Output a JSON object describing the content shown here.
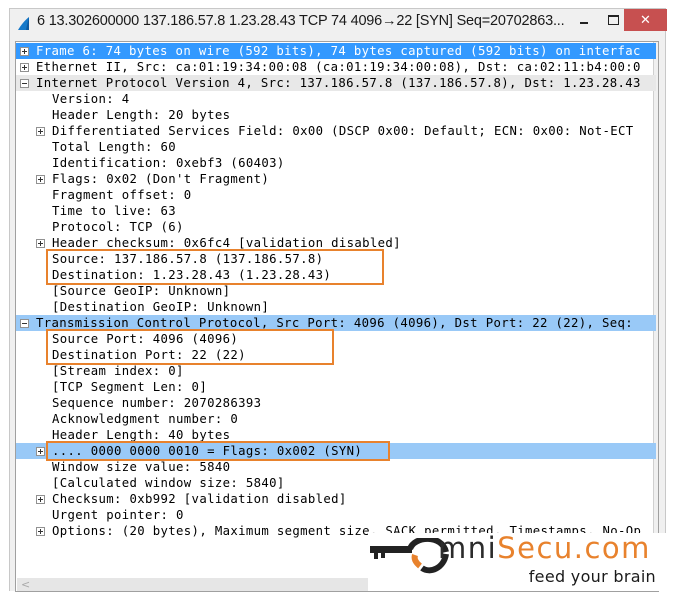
{
  "window": {
    "title": "6 13.302600000 137.186.57.8 1.23.28.43 TCP 74 4096→22 [SYN] Seq=20702863...",
    "app_icon": "wireshark-fin-icon",
    "controls": {
      "minimize": "minimize-icon",
      "maximize": "maximize-icon",
      "close": "✕"
    }
  },
  "tree": {
    "rows": [
      {
        "text": "Frame 6: 74 bytes on wire (592 bits), 74 bytes captured (592 bits) on interfac",
        "level": 0,
        "expander": "plus",
        "state": "selected"
      },
      {
        "text": "Ethernet II, Src: ca:01:19:34:00:08 (ca:01:19:34:00:08), Dst: ca:02:11:b4:00:0",
        "level": 0,
        "expander": "plus",
        "state": "normal"
      },
      {
        "text": "Internet Protocol Version 4, Src: 137.186.57.8 (137.186.57.8), Dst: 1.23.28.43",
        "level": 0,
        "expander": "minus",
        "state": "hover"
      },
      {
        "text": "Version: 4",
        "level": 1,
        "expander": "none",
        "state": "normal"
      },
      {
        "text": "Header Length: 20 bytes",
        "level": 1,
        "expander": "none",
        "state": "normal"
      },
      {
        "text": "Differentiated Services Field: 0x00 (DSCP 0x00: Default; ECN: 0x00: Not-ECT",
        "level": 1,
        "expander": "plus",
        "state": "normal"
      },
      {
        "text": "Total Length: 60",
        "level": 1,
        "expander": "none",
        "state": "normal"
      },
      {
        "text": "Identification: 0xebf3 (60403)",
        "level": 1,
        "expander": "none",
        "state": "normal"
      },
      {
        "text": "Flags: 0x02 (Don't Fragment)",
        "level": 1,
        "expander": "plus",
        "state": "normal"
      },
      {
        "text": "Fragment offset: 0",
        "level": 1,
        "expander": "none",
        "state": "normal"
      },
      {
        "text": "Time to live: 63",
        "level": 1,
        "expander": "none",
        "state": "normal"
      },
      {
        "text": "Protocol: TCP (6)",
        "level": 1,
        "expander": "none",
        "state": "normal"
      },
      {
        "text": "Header checksum: 0x6fc4 [validation disabled]",
        "level": 1,
        "expander": "plus",
        "state": "normal"
      },
      {
        "text": "Source: 137.186.57.8 (137.186.57.8)",
        "level": 1,
        "expander": "none",
        "state": "normal"
      },
      {
        "text": "Destination: 1.23.28.43 (1.23.28.43)",
        "level": 1,
        "expander": "none",
        "state": "normal"
      },
      {
        "text": "[Source GeoIP: Unknown]",
        "level": 1,
        "expander": "none",
        "state": "normal"
      },
      {
        "text": "[Destination GeoIP: Unknown]",
        "level": 1,
        "expander": "none",
        "state": "normal"
      },
      {
        "text": "Transmission Control Protocol, Src Port: 4096 (4096), Dst Port: 22 (22), Seq:",
        "level": 0,
        "expander": "minus",
        "state": "selected-light"
      },
      {
        "text": "Source Port: 4096 (4096)",
        "level": 1,
        "expander": "none",
        "state": "normal"
      },
      {
        "text": "Destination Port: 22 (22)",
        "level": 1,
        "expander": "none",
        "state": "normal"
      },
      {
        "text": "[Stream index: 0]",
        "level": 1,
        "expander": "none",
        "state": "normal"
      },
      {
        "text": "[TCP Segment Len: 0]",
        "level": 1,
        "expander": "none",
        "state": "normal"
      },
      {
        "text": "Sequence number: 2070286393",
        "level": 1,
        "expander": "none",
        "state": "normal"
      },
      {
        "text": "Acknowledgment number: 0",
        "level": 1,
        "expander": "none",
        "state": "normal"
      },
      {
        "text": "Header Length: 40 bytes",
        "level": 1,
        "expander": "none",
        "state": "normal"
      },
      {
        "text": ".... 0000 0000 0010 = Flags: 0x002 (SYN)",
        "level": 1,
        "expander": "plus",
        "state": "selected-light"
      },
      {
        "text": "Window size value: 5840",
        "level": 1,
        "expander": "none",
        "state": "normal"
      },
      {
        "text": "[Calculated window size: 5840]",
        "level": 1,
        "expander": "none",
        "state": "normal"
      },
      {
        "text": "Checksum: 0xb992 [validation disabled]",
        "level": 1,
        "expander": "plus",
        "state": "normal"
      },
      {
        "text": "Urgent pointer: 0",
        "level": 1,
        "expander": "none",
        "state": "normal"
      },
      {
        "text": "Options: (20 bytes), Maximum segment size, SACK permitted, Timestamps, No-Op",
        "level": 1,
        "expander": "plus",
        "state": "normal"
      }
    ],
    "highlight_boxes": [
      {
        "label": "ip-source-destination-highlight",
        "rows": [
          13,
          14
        ]
      },
      {
        "label": "tcp-ports-highlight",
        "rows": [
          18,
          19
        ]
      },
      {
        "label": "tcp-flags-highlight",
        "rows": [
          25,
          25
        ]
      }
    ],
    "scroll_left_arrow": "<"
  },
  "watermark": {
    "brand_prefix": "O",
    "brand_dark": "mni",
    "brand_accent": "Secu.com",
    "tagline": "feed your brain",
    "icon": "key-icon"
  },
  "colors": {
    "selection": "#3399ff",
    "selection_light": "#99c9f7",
    "highlight_box": "#e8822d",
    "close_button": "#c75050",
    "brand_accent": "#e8822d"
  }
}
